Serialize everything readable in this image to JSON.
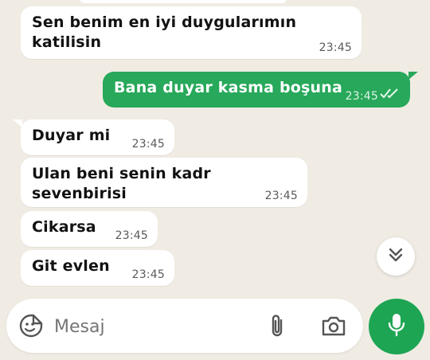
{
  "messages": [
    {
      "direction": "in",
      "text": "Sen benim en i̇yi̇ duygularımın kati̇li̇si̇n",
      "time": "23:45"
    },
    {
      "direction": "out",
      "text": "Bana duyar kasma boşuna",
      "time": "23:45",
      "status": "read"
    },
    {
      "direction": "in",
      "text": "Duyar mi̇",
      "time": "23:45"
    },
    {
      "direction": "in",
      "text": "Ulan beni̇ seni̇n kadr sevenbi̇ri̇si̇",
      "time": "23:45"
    },
    {
      "direction": "in",
      "text": "Ci̇karsa",
      "time": "23:45"
    },
    {
      "direction": "in",
      "text": "Gi̇t evlen",
      "time": "23:45"
    }
  ],
  "composer": {
    "placeholder": "Mesaj"
  },
  "icons": {
    "emoji": "sticker-smile-icon",
    "attach": "paperclip-icon",
    "camera": "camera-icon",
    "mic": "microphone-icon",
    "scroll": "double-chevron-down-icon"
  },
  "colors": {
    "background": "#f0ece4",
    "incoming": "#ffffff",
    "outgoing": "#27a85a",
    "accent": "#1ea553"
  }
}
